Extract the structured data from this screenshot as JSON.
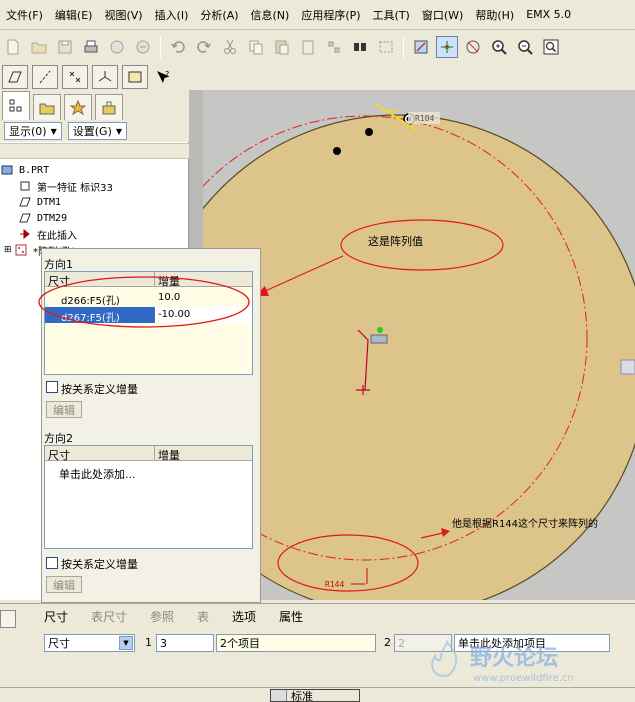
{
  "menubar": {
    "items": [
      "文件(F)",
      "编辑(E)",
      "视图(V)",
      "插入(I)",
      "分析(A)",
      "信息(N)",
      "应用程序(P)",
      "工具(T)",
      "窗口(W)",
      "帮助(H)",
      "EMX 5.0"
    ]
  },
  "navigator": {
    "show_button": "显示(0)",
    "settings_button": "设置(G)",
    "tree": [
      {
        "label": "B.PRT",
        "icon": "part-icon"
      },
      {
        "label": "第一特征 标识33",
        "icon": "feature-icon"
      },
      {
        "label": "DTM1",
        "icon": "datum-plane-icon"
      },
      {
        "label": "DTM29",
        "icon": "datum-plane-icon"
      },
      {
        "label": "在此插入",
        "icon": "insert-arrow-icon"
      },
      {
        "label": "*阵列(孔)",
        "icon": "pattern-icon"
      }
    ]
  },
  "pattern_dialog": {
    "direction1_label": "方向1",
    "col_dimension": "尺寸",
    "col_increment": "增量",
    "rows": [
      {
        "dimension": "d266:F5(孔)",
        "increment": "10.0",
        "selected": false
      },
      {
        "dimension": "d267:F5(孔)",
        "increment": "-10.00",
        "selected": true
      }
    ],
    "relation_checkbox1": "按关系定义增量",
    "edit_button1": "编辑",
    "direction2_label": "方向2",
    "dir2_col_dimension": "尺寸",
    "dir2_col_increment": "增量",
    "dir2_placeholder": "单击此处添加...",
    "relation_checkbox2": "按关系定义增量",
    "edit_button2": "编辑"
  },
  "graphics": {
    "dimension_top": "R104",
    "dimension_bottom": "R144",
    "annotation_pattern_values": "这是阵列值",
    "annotation_r144": "他是根据R144这个尺寸来阵列的"
  },
  "dashboard": {
    "tabs": [
      "尺寸",
      "表尺寸",
      "参照",
      "表",
      "选项",
      "属性"
    ],
    "type_select": "尺寸",
    "dir1_num": "1",
    "dir1_count": "3",
    "items_field": "2个项目",
    "dir2_num": "2",
    "dir2_count": "2",
    "add_item": "单击此处添加项目"
  },
  "statusbar": {
    "filter_label": "标准"
  },
  "watermark": {
    "logo_text": "野火论坛",
    "url": "www.proewildfire.cn"
  },
  "colors": {
    "part_fill": "#dcc48a",
    "dashed_circle": "#e02020",
    "annotation_red": "#e01818",
    "selection_blue": "#316ac5",
    "background_grey": "#c6c6c4"
  }
}
